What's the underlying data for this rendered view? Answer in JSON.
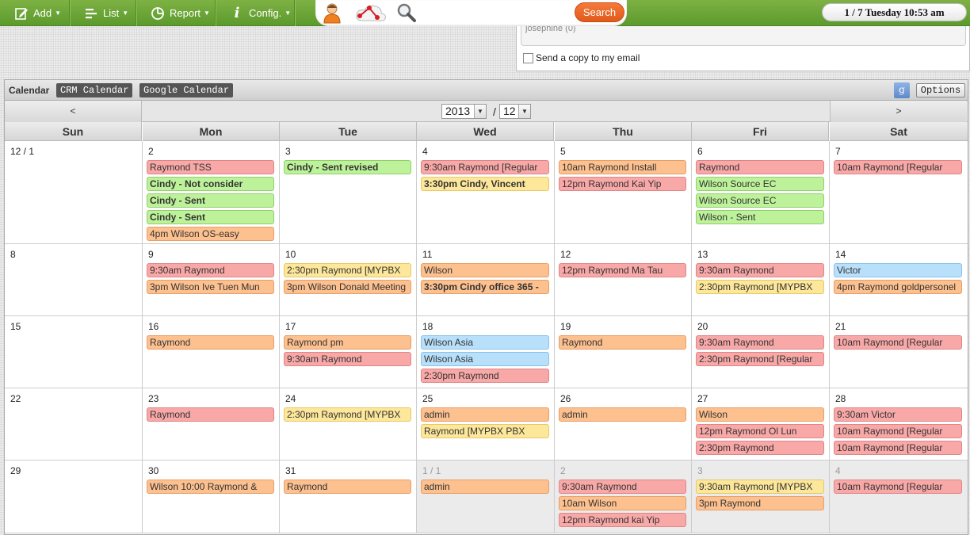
{
  "toolbar": {
    "add": "Add",
    "list": "List",
    "report": "Report",
    "config": "Config.",
    "search": "Search",
    "datetime": "1 / 7  Tuesday  10:53 am"
  },
  "email_panel": {
    "recipient": "josephine (0)",
    "copy_label": "Send a copy to my email"
  },
  "calendar": {
    "title": "Calendar",
    "tabs": [
      "CRM Calendar",
      "Google Calendar"
    ],
    "google_icon": "g",
    "options": "Options",
    "prev": "<",
    "next": ">",
    "year": "2013",
    "slash": "/",
    "month": "12",
    "days_of_week": [
      "Sun",
      "Mon",
      "Tue",
      "Wed",
      "Thu",
      "Fri",
      "Sat"
    ],
    "colors": {
      "red": "#f9a8a8",
      "green": "#bdf29a",
      "orange": "#fdc08f",
      "yellow": "#fde79a",
      "blue": "#b9e0fb"
    },
    "weeks": [
      {
        "days": [
          {
            "num": "12 / 1",
            "events": []
          },
          {
            "num": "2",
            "events": [
              {
                "text": "Raymond TSS",
                "color": "red"
              },
              {
                "text": "Cindy  - Not consider",
                "color": "green",
                "bold": true
              },
              {
                "text": "Cindy  - Sent",
                "color": "green",
                "bold": true
              },
              {
                "text": "Cindy  - Sent",
                "color": "green",
                "bold": true
              },
              {
                "text": "4pm Wilson OS-easy",
                "color": "orange"
              }
            ]
          },
          {
            "num": "3",
            "events": [
              {
                "text": "Cindy  - Sent revised",
                "color": "green",
                "bold": true
              }
            ]
          },
          {
            "num": "4",
            "events": [
              {
                "text": "9:30am Raymond [Regular",
                "color": "red"
              },
              {
                "text": "3:30pm Cindy, Vincent",
                "color": "yellow",
                "bold": true
              }
            ]
          },
          {
            "num": "5",
            "events": [
              {
                "text": "10am Raymond Install",
                "color": "orange"
              },
              {
                "text": "12pm Raymond Kai Yip",
                "color": "red"
              }
            ]
          },
          {
            "num": "6",
            "events": [
              {
                "text": "Raymond",
                "color": "red"
              },
              {
                "text": "Wilson Source EC",
                "color": "green"
              },
              {
                "text": "Wilson Source EC",
                "color": "green"
              },
              {
                "text": "Wilson  - Sent",
                "color": "green"
              }
            ]
          },
          {
            "num": "7",
            "events": [
              {
                "text": "10am Raymond [Regular",
                "color": "red"
              }
            ]
          }
        ]
      },
      {
        "days": [
          {
            "num": "8",
            "events": []
          },
          {
            "num": "9",
            "events": [
              {
                "text": "9:30am Raymond",
                "color": "red"
              },
              {
                "text": "3pm Wilson Ive Tuen Mun",
                "color": "orange"
              }
            ]
          },
          {
            "num": "10",
            "events": [
              {
                "text": "2:30pm Raymond [MYPBX",
                "color": "yellow"
              },
              {
                "text": "3pm Wilson Donald Meeting",
                "color": "orange"
              }
            ]
          },
          {
            "num": "11",
            "events": [
              {
                "text": "Wilson",
                "color": "orange"
              },
              {
                "text": "3:30pm Cindy office 365 -",
                "color": "orange",
                "bold": true
              }
            ]
          },
          {
            "num": "12",
            "events": [
              {
                "text": "12pm Raymond Ma Tau",
                "color": "red"
              }
            ]
          },
          {
            "num": "13",
            "events": [
              {
                "text": "9:30am Raymond",
                "color": "red"
              },
              {
                "text": "2:30pm Raymond [MYPBX",
                "color": "yellow"
              }
            ]
          },
          {
            "num": "14",
            "events": [
              {
                "text": "Victor",
                "color": "blue"
              },
              {
                "text": "4pm Raymond goldpersonel",
                "color": "orange"
              }
            ]
          }
        ]
      },
      {
        "days": [
          {
            "num": "15",
            "events": []
          },
          {
            "num": "16",
            "events": [
              {
                "text": "Raymond",
                "color": "orange"
              }
            ]
          },
          {
            "num": "17",
            "events": [
              {
                "text": "Raymond pm",
                "color": "orange"
              },
              {
                "text": "9:30am Raymond",
                "color": "red"
              }
            ]
          },
          {
            "num": "18",
            "events": [
              {
                "text": "Wilson  Asia",
                "color": "blue"
              },
              {
                "text": "Wilson  Asia",
                "color": "blue"
              },
              {
                "text": "2:30pm Raymond",
                "color": "red"
              }
            ]
          },
          {
            "num": "19",
            "events": [
              {
                "text": "Raymond",
                "color": "orange"
              }
            ]
          },
          {
            "num": "20",
            "events": [
              {
                "text": "9:30am Raymond",
                "color": "red"
              },
              {
                "text": "2:30pm Raymond [Regular",
                "color": "red"
              }
            ]
          },
          {
            "num": "21",
            "events": [
              {
                "text": "10am Raymond [Regular",
                "color": "red"
              }
            ]
          }
        ]
      },
      {
        "days": [
          {
            "num": "22",
            "events": []
          },
          {
            "num": "23",
            "events": [
              {
                "text": "Raymond",
                "color": "red"
              }
            ]
          },
          {
            "num": "24",
            "events": [
              {
                "text": "2:30pm Raymond [MYPBX",
                "color": "yellow"
              }
            ]
          },
          {
            "num": "25",
            "events": [
              {
                "text": "admin",
                "color": "orange"
              },
              {
                "text": "Raymond [MYPBX PBX",
                "color": "yellow"
              }
            ]
          },
          {
            "num": "26",
            "events": [
              {
                "text": "admin",
                "color": "orange"
              }
            ]
          },
          {
            "num": "27",
            "events": [
              {
                "text": "Wilson",
                "color": "orange"
              },
              {
                "text": "12pm Raymond Ol Lun",
                "color": "red"
              },
              {
                "text": "2:30pm Raymond",
                "color": "red"
              }
            ]
          },
          {
            "num": "28",
            "events": [
              {
                "text": "9:30am Victor",
                "color": "red"
              },
              {
                "text": "10am Raymond [Regular",
                "color": "red"
              },
              {
                "text": "10am Raymond [Regular",
                "color": "red"
              }
            ]
          }
        ]
      },
      {
        "days": [
          {
            "num": "29",
            "events": []
          },
          {
            "num": "30",
            "events": [
              {
                "text": "Wilson 10:00 Raymond &",
                "color": "orange"
              }
            ]
          },
          {
            "num": "31",
            "events": [
              {
                "text": "Raymond",
                "color": "orange"
              }
            ]
          },
          {
            "num": "1 / 1",
            "other": true,
            "events": [
              {
                "text": "admin",
                "color": "orange"
              }
            ]
          },
          {
            "num": "2",
            "other": true,
            "events": [
              {
                "text": "9:30am Raymond",
                "color": "red"
              },
              {
                "text": "10am Wilson",
                "color": "orange"
              },
              {
                "text": "12pm Raymond kai Yip",
                "color": "red"
              }
            ]
          },
          {
            "num": "3",
            "other": true,
            "events": [
              {
                "text": "9:30am Raymond [MYPBX",
                "color": "yellow"
              },
              {
                "text": "3pm Raymond",
                "color": "orange"
              }
            ]
          },
          {
            "num": "4",
            "other": true,
            "events": [
              {
                "text": "10am Raymond [Regular",
                "color": "red"
              }
            ]
          }
        ]
      }
    ]
  }
}
